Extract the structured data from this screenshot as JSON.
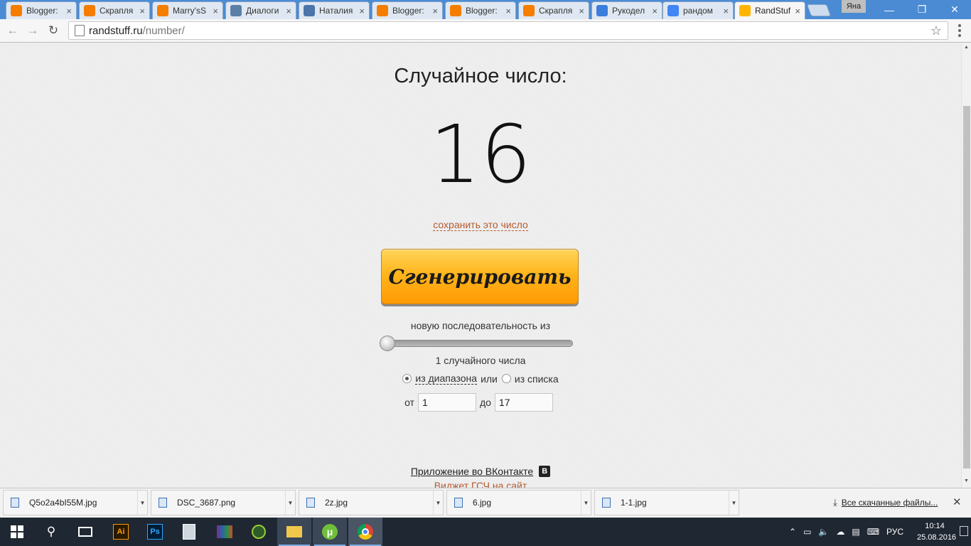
{
  "browser": {
    "tabs": [
      {
        "title": "Blogger:",
        "favicon": "blogger-icon",
        "color": "#f57d00"
      },
      {
        "title": "Скрапля",
        "favicon": "blogger-icon",
        "color": "#f57d00"
      },
      {
        "title": "Marry'sS",
        "favicon": "blogger-icon",
        "color": "#f57d00"
      },
      {
        "title": "Диалоги",
        "favicon": "chat-icon",
        "color": "#5b7fa6"
      },
      {
        "title": "Наталия",
        "favicon": "vk-icon",
        "color": "#4a76a8"
      },
      {
        "title": "Blogger:",
        "favicon": "blogger-icon",
        "color": "#f57d00"
      },
      {
        "title": "Blogger:",
        "favicon": "blogger-icon",
        "color": "#f57d00"
      },
      {
        "title": "Скрапля",
        "favicon": "blogger-icon",
        "color": "#f57d00"
      },
      {
        "title": "Рукодел",
        "favicon": "loading-icon",
        "color": "#3b7ddd"
      },
      {
        "title": "рандом",
        "favicon": "google-icon",
        "color": "#4285f4"
      },
      {
        "title": "RandStuf",
        "favicon": "randstuff-icon",
        "color": "#ffb400"
      }
    ],
    "user_name": "Яна",
    "url_host": "randstuff.ru",
    "url_path": "/number/"
  },
  "page": {
    "heading": "Случайное число:",
    "result": "16",
    "save_link": "сохранить это число",
    "generate_button": "Сгенерировать",
    "sequence_label": "новую последовательность из",
    "count_label": "1 случайного числа",
    "mode_range": "из диапазона",
    "mode_or": "или",
    "mode_list": "из списка",
    "from_label": "от",
    "from_value": "1",
    "to_label": "до",
    "to_value": "17",
    "vk_app_link": "Приложение во ВКонтакте",
    "vk_badge": "В",
    "widget_link": "Виджет ГСЧ на сайт"
  },
  "downloads": {
    "items": [
      "Q5o2a4bI55M.jpg",
      "DSC_3687.png",
      "2z.jpg",
      "6.jpg",
      "1-1.jpg"
    ],
    "show_all": "Все скачанные файлы..."
  },
  "taskbar": {
    "language": "РУС",
    "time": "10:14",
    "date": "25.08.2016"
  }
}
